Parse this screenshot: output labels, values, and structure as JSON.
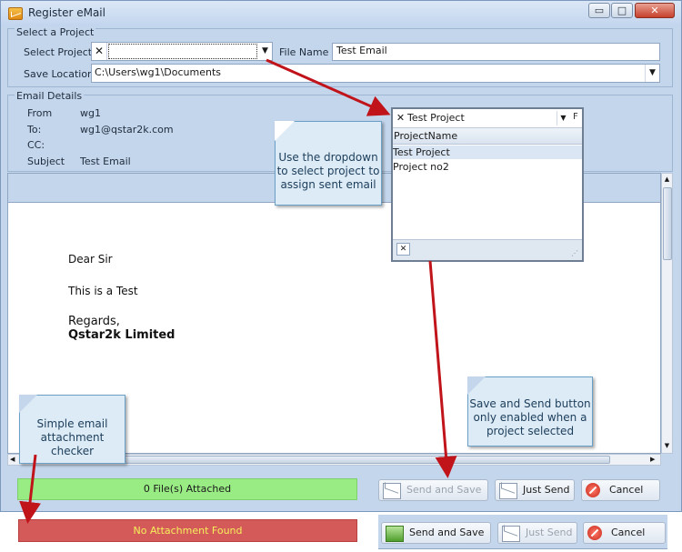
{
  "window": {
    "title": "Register eMail",
    "min_label": "▭",
    "max_label": "□",
    "close_label": "✕"
  },
  "select_project": {
    "group_title": "Select a Project",
    "project_label": "Select Project",
    "project_value": "",
    "clear_glyph": "✕",
    "filename_label": "File Name",
    "filename_value": "Test Email",
    "save_label": "Save Location",
    "save_value": "C:\\Users\\wg1\\Documents"
  },
  "email_details": {
    "group_title": "Email Details",
    "from_label": "From",
    "from_value": "wg1",
    "to_label": "To:",
    "to_value": "wg1@qstar2k.com",
    "cc_label": "CC:",
    "subject_label": "Subject",
    "subject_value": "Test Email"
  },
  "email_body": {
    "greeting": "Dear Sir",
    "line1": "This is a Test",
    "regards": "Regards,",
    "signature": "Qstar2k Limited"
  },
  "dropdown": {
    "selected": "Test Project",
    "column_header": "ProjectName",
    "rows": [
      "Test Project",
      "Project no2"
    ],
    "cut_off_label": "F"
  },
  "callouts": {
    "dropdown_tip": "Use the dropdown to select project to assign sent email",
    "save_send_tip": "Save and Send button only enabled when a project selected",
    "attachment_tip": "Simple email attachment checker"
  },
  "footer": {
    "attachments": "0 File(s) Attached",
    "send_and_save": "Send and Save",
    "just_send": "Just Send",
    "cancel": "Cancel"
  },
  "alt_footer": {
    "no_attachment": "No Attachment Found",
    "send_and_save": "Send and Save",
    "just_send": "Just Send",
    "cancel": "Cancel"
  },
  "colors": {
    "window_bg": "#c4d6ec",
    "attached_ok": "#99ec84",
    "no_attachment": "#d45a5a",
    "arrow": "#c0141a",
    "callout_bg": "#dcebf6"
  }
}
